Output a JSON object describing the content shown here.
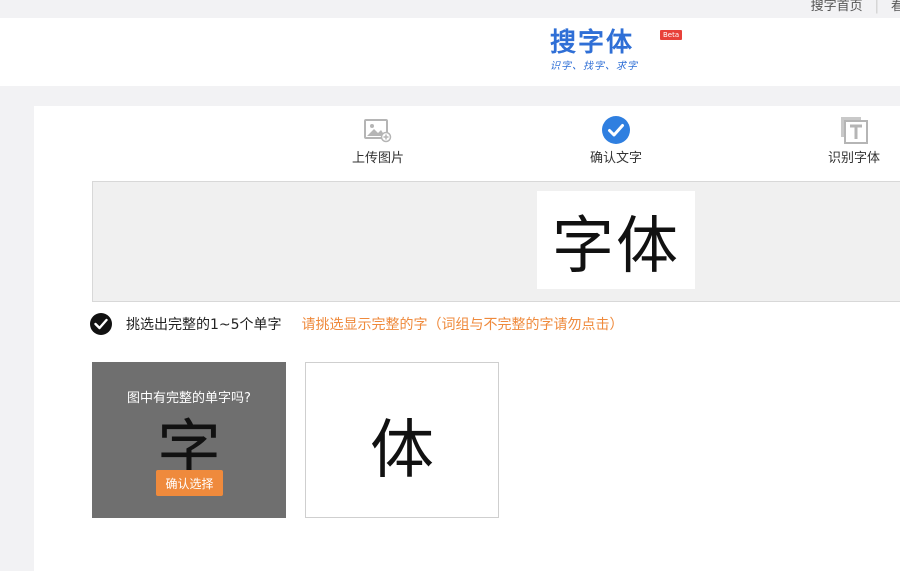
{
  "topnav": {
    "items": [
      "搜字首页",
      "看"
    ]
  },
  "logo": {
    "title": "搜字体",
    "badge": "Beta",
    "tagline": "识字、找字、求字"
  },
  "steps": [
    {
      "label": "上传图片",
      "icon": "image-icon",
      "state": "done"
    },
    {
      "label": "确认文字",
      "icon": "check-circle-icon",
      "state": "current"
    },
    {
      "label": "识别字体",
      "icon": "font-t-icon",
      "state": "pending"
    }
  ],
  "preview": {
    "text": "字体"
  },
  "instruction": {
    "main": "挑选出完整的1~5个单字",
    "hint": "请挑选显示完整的字（词组与不完整的字请勿点击）"
  },
  "candidates": [
    {
      "char": "字",
      "overlay_question": "图中有完整的单字吗?",
      "confirm_label": "确认选择"
    },
    {
      "char": "体"
    }
  ],
  "colors": {
    "accent_blue": "#2f6fd6",
    "accent_orange": "#ef8a3c",
    "badge_red": "#e8413a"
  }
}
